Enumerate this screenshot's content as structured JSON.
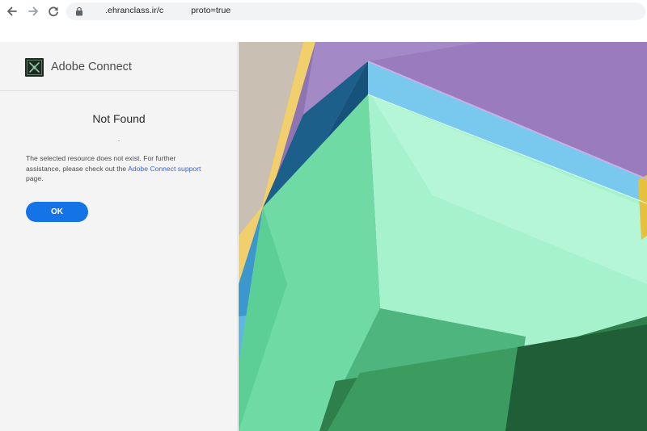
{
  "browser": {
    "url_prefix": ".ehranclass.ir/c",
    "url_suffix": "proto=true"
  },
  "panel": {
    "brand": "Adobe Connect",
    "title": "Not Found",
    "message_before": "The selected resource does not exist. For further assistance, please check out the ",
    "link_text": "Adobe Connect support",
    "message_after": " page.",
    "ok_label": "OK"
  },
  "icons": {
    "back": "back-arrow-icon",
    "forward": "forward-arrow-icon",
    "reload": "reload-icon",
    "lock": "lock-icon",
    "logo": "adobe-connect-logo-icon"
  },
  "colors": {
    "primary_button": "#1473e6",
    "link": "#3b63d6",
    "panel_bg": "#f4f4f4"
  }
}
